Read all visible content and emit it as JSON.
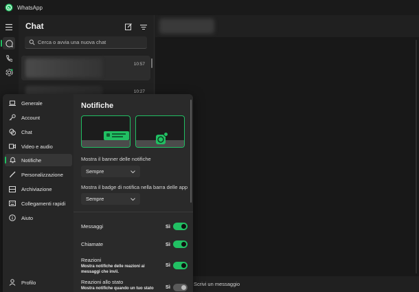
{
  "window": {
    "title": "WhatsApp",
    "accent": "#21c063"
  },
  "rail": {
    "items": [
      "menu-icon",
      "chats-icon",
      "calls-icon",
      "status-icon"
    ]
  },
  "chatlist": {
    "title": "Chat",
    "search_placeholder": "Cerca o avvia una nuova chat",
    "rows": [
      {
        "time": "10:57"
      },
      {
        "time": "10:27"
      }
    ]
  },
  "conversation": {
    "message_placeholder": "Scrivi un messaggio"
  },
  "settings": {
    "nav": [
      {
        "label": "Generale",
        "icon": "laptop-icon"
      },
      {
        "label": "Account",
        "icon": "key-icon"
      },
      {
        "label": "Chat",
        "icon": "chat-bubbles-icon"
      },
      {
        "label": "Video e audio",
        "icon": "video-icon"
      },
      {
        "label": "Notifiche",
        "icon": "bell-icon",
        "active": true
      },
      {
        "label": "Personalizzazione",
        "icon": "brush-icon"
      },
      {
        "label": "Archiviazione",
        "icon": "storage-icon"
      },
      {
        "label": "Collegamenti rapidi",
        "icon": "keyboard-icon"
      },
      {
        "label": "Aiuto",
        "icon": "info-icon"
      }
    ],
    "profile_label": "Profilo",
    "panel": {
      "title": "Notifiche",
      "banner_label": "Mostra il banner delle notifiche",
      "banner_value": "Sempre",
      "badge_label": "Mostra il badge di notifica nella barra delle app",
      "badge_value": "Sempre",
      "toggles": [
        {
          "name": "Messaggi",
          "state": "Sì",
          "on": true
        },
        {
          "name": "Chiamate",
          "state": "Sì",
          "on": true
        },
        {
          "name": "Reazioni",
          "desc": "Mostra notifiche delle reazioni ai messaggi che invii.",
          "state": "Sì",
          "on": true
        },
        {
          "name": "Reazioni allo stato",
          "desc": "Mostra notifiche quando un tuo stato",
          "state": "Sì",
          "on": false
        }
      ]
    }
  }
}
